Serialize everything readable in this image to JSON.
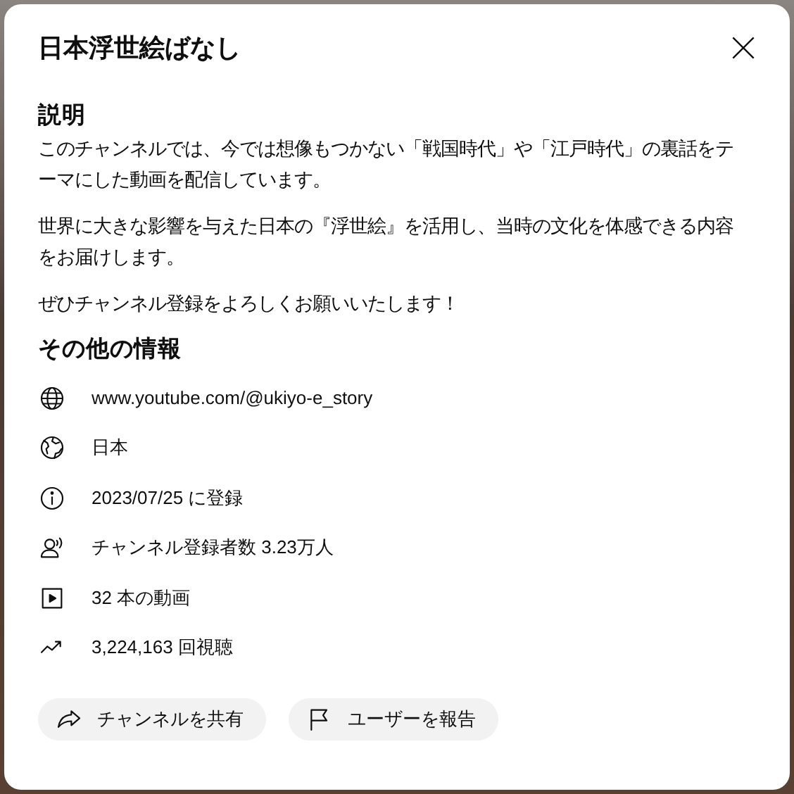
{
  "dialog": {
    "title": "日本浮世絵ばなし"
  },
  "description": {
    "heading": "説明",
    "paragraphs": [
      "このチャンネルでは、今では想像もつかない「戦国時代」や「江戸時代」の裏話をテーマにした動画を配信しています。",
      "世界に大きな影響を与えた日本の『浮世絵』を活用し、当時の文化を体感できる内容をお届けします。",
      "ぜひチャンネル登録をよろしくお願いいたします！"
    ]
  },
  "details": {
    "heading": "その他の情報",
    "items": [
      {
        "kind": "link",
        "text": "www.youtube.com/@ukiyo-e_story"
      },
      {
        "kind": "country",
        "text": "日本"
      },
      {
        "kind": "joined",
        "text": "2023/07/25 に登録"
      },
      {
        "kind": "subscribers",
        "text": "チャンネル登録者数 3.23万人"
      },
      {
        "kind": "videos",
        "text": "32 本の動画"
      },
      {
        "kind": "views",
        "text": "3,224,163 回視聴"
      }
    ]
  },
  "actions": [
    {
      "kind": "share",
      "label": "チャンネルを共有"
    },
    {
      "kind": "report",
      "label": "ユーザーを報告"
    }
  ]
}
